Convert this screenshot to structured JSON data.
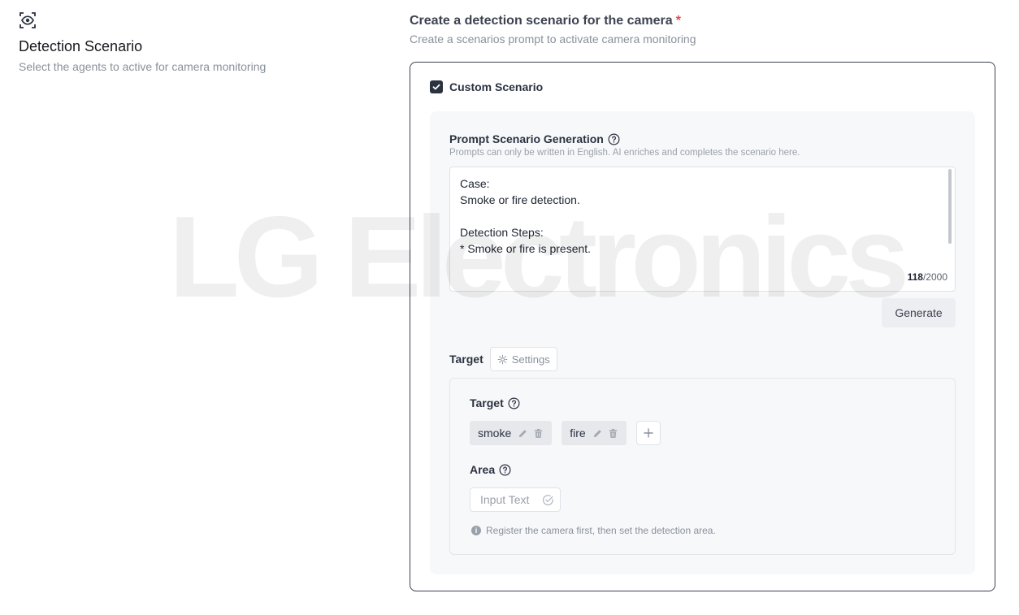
{
  "watermark": "LG Electronics",
  "left": {
    "icon": "eye-scan-icon",
    "title": "Detection Scenario",
    "description": "Select the agents to active for camera monitoring"
  },
  "right": {
    "heading": "Create a detection scenario for the camera",
    "required_mark": "*",
    "subheading": "Create a scenarios prompt to activate camera monitoring"
  },
  "custom_scenario": {
    "checked": true,
    "label": "Custom Scenario"
  },
  "prompt": {
    "title": "Prompt Scenario Generation",
    "hint": "Prompts can only be written in English. AI enriches and completes the scenario here.",
    "lines": [
      "Case:",
      "Smoke or fire detection.",
      "",
      "Detection Steps:",
      "* Smoke or fire is present."
    ],
    "count": "118",
    "max": "/2000",
    "generate_label": "Generate"
  },
  "target": {
    "label": "Target",
    "settings_label": "Settings",
    "inner_label": "Target",
    "tags": [
      {
        "label": "smoke"
      },
      {
        "label": "fire"
      }
    ]
  },
  "area": {
    "label": "Area",
    "placeholder": "Input Text",
    "info": "Register the camera first, then set the detection area."
  },
  "colors": {
    "accent": "#2b3240",
    "required": "#e5484d",
    "panel_bg": "#f7f8fa",
    "tag_bg": "#e6e8ec"
  }
}
